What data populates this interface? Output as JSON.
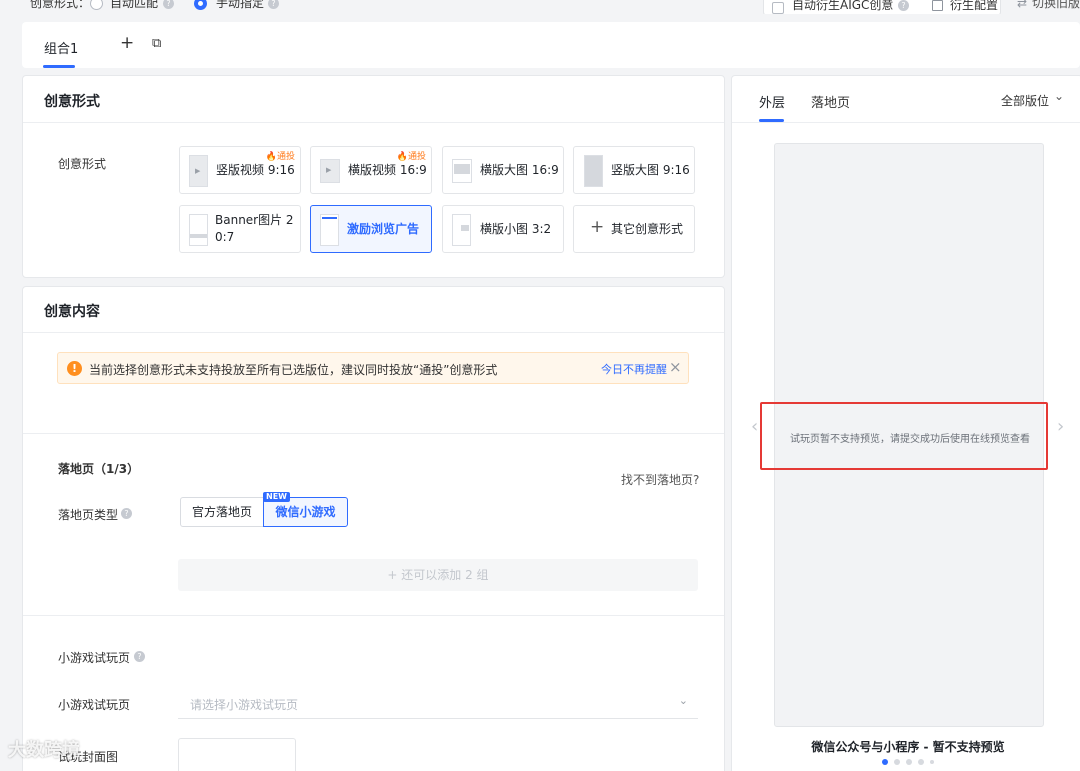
{
  "top": {
    "mode_label": "创意形式：",
    "option_auto": "自动匹配",
    "option_manual": "手动指定",
    "aigc_label": "自动衍生AIGC创意",
    "derive_config": "衍生配置",
    "switch_old": "切换旧版"
  },
  "tabs": {
    "group1": "组合1",
    "add": "+",
    "copy": "⧉"
  },
  "format_card": {
    "title": "创意形式",
    "label": "创意形式",
    "hot_badge": "🔥通投",
    "items": [
      {
        "label": "竖版视频 9:16"
      },
      {
        "label": "横版视频 16:9"
      },
      {
        "label": "横版大图 16:9"
      },
      {
        "label": "竖版大图 9:16"
      },
      {
        "label": "Banner图片 20:7"
      },
      {
        "label": "激励浏览广告"
      },
      {
        "label": "横版小图 3:2"
      },
      {
        "label": "其它创意形式"
      }
    ]
  },
  "content_card": {
    "title": "创意内容",
    "alert_text": "当前选择创意形式未支持投放至所有已选版位，建议同时投放“通投”创意形式",
    "alert_dismiss": "今日不再提醒",
    "alert_close": "×",
    "landing_title": "落地页（1/3）",
    "landing_help": "找不到落地页?",
    "landing_type_label": "落地页类型",
    "seg_official": "官方落地页",
    "seg_minigame": "微信小游戏",
    "new_badge": "NEW",
    "add_more": "+ 还可以添加 2 组",
    "trial_title": "小游戏试玩页",
    "trial_label": "小游戏试玩页",
    "trial_placeholder": "请选择小游戏试玩页",
    "thumb_label": "试玩封面图"
  },
  "preview": {
    "tab_outer": "外层",
    "tab_landing": "落地页",
    "placement": "全部版位",
    "message": "试玩页暂不支持预览，请提交成功后使用在线预览查看",
    "caption": "微信公众号与小程序 - 暂不支持预览",
    "pages": 5,
    "current_page": 1
  },
  "watermark": "大数跨境",
  "colors": {
    "accent": "#2f6bff",
    "warning": "#ff8f1f",
    "highlight": "#e53935"
  }
}
